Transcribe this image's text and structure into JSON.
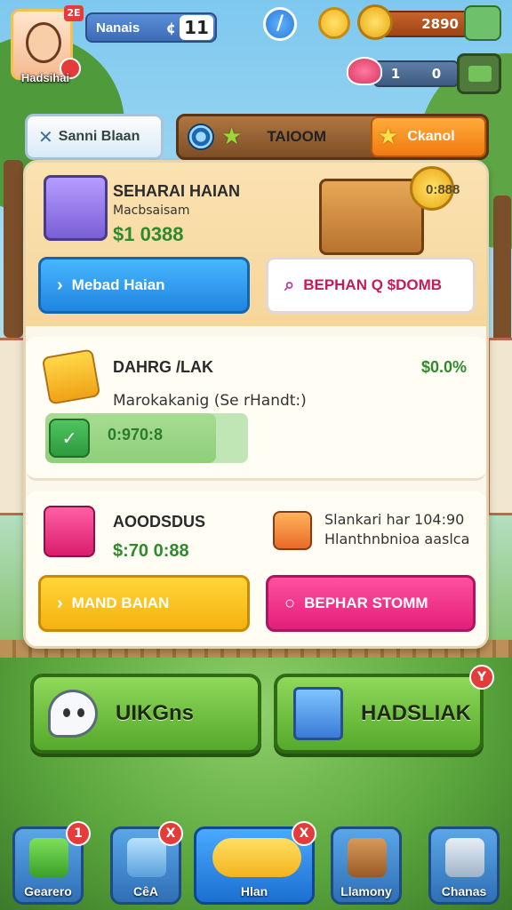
{
  "player": {
    "name": "Hadsihai",
    "level_badge": "2E",
    "display_name": "Nanais",
    "symbol": "¢",
    "rank": "11"
  },
  "resources": {
    "coins": "2890",
    "gems_left": "1",
    "gems_right": "0"
  },
  "tabs": {
    "back_label": "Sanni Blaan",
    "middle_label": "TAIOOM",
    "active_label": "Ckanol"
  },
  "card1": {
    "title": "SEHARAI HAIAN",
    "subtitle": "Macbsaisam",
    "money": "$1 0388",
    "coin_value": "0:888",
    "btn_primary": "Mebad Haian",
    "btn_secondary": "BEPHAN Q $DOMB"
  },
  "card2": {
    "title": "DAHRG /LAK",
    "money_right": "$0.0%",
    "description": "Marokakanig  (Se rHandt:)",
    "progress_value": "0:970:8",
    "progress_fraction": 0.84
  },
  "card3": {
    "title": "AOODSDUS",
    "money": "$:70 0:88",
    "info_line1": "Slankari har 104:90",
    "info_line2": "Hlanthnbnioa aaslca",
    "btn_primary": "MAND BAIAN",
    "btn_secondary": "BEPHAR STOMM"
  },
  "big_buttons": {
    "left_label": "UIKGns",
    "right_label": "HADSLIAK",
    "right_badge": "Y"
  },
  "nav": {
    "items": [
      {
        "label": "Gearero",
        "badge": "1"
      },
      {
        "label": "CêA",
        "badge": "X"
      },
      {
        "label": "Hlan",
        "badge": "X"
      },
      {
        "label": "Llamony"
      },
      {
        "label": "Chanas"
      }
    ]
  },
  "colors": {
    "accent_green": "#2d8a2d",
    "accent_blue": "#1f86e0",
    "accent_pink": "#e21f7a",
    "accent_yellow": "#f5b20e",
    "accent_orange": "#f07a11"
  },
  "icons": {
    "avatar": "girl-portrait",
    "edit": "pencil-icon",
    "speed": "lightning-icon",
    "coin": "coin-icon",
    "gem": "gem-icon",
    "cash": "cash-icon",
    "map": "map-icon"
  }
}
